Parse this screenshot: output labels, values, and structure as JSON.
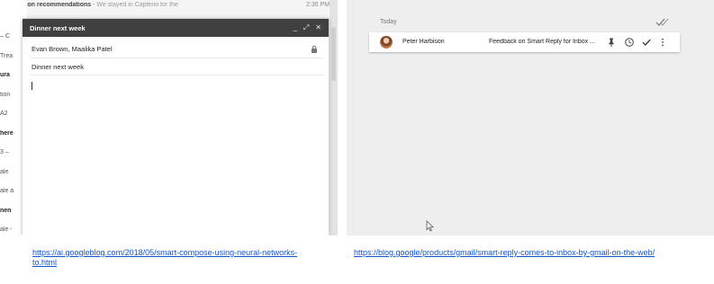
{
  "left_screenshot": {
    "background_inbox": {
      "top_text_bold": "ng/vacation recommendations",
      "top_text_rest": " - We stayed in Capterio for the",
      "top_time": "2:35 PM",
      "rows": [
        {
          "text": "– C",
          "bold": false
        },
        {
          "text": "Trea",
          "bold": false
        },
        {
          "text": "ura",
          "bold": true
        },
        {
          "text": "tion",
          "bold": false
        },
        {
          "text": "A2",
          "bold": false
        },
        {
          "text": "here",
          "bold": true
        },
        {
          "text": "3 –",
          "bold": false
        },
        {
          "text": "ale",
          "bold": false
        },
        {
          "text": "ale a",
          "bold": false
        },
        {
          "text": "nen",
          "bold": true
        },
        {
          "text": "ale -",
          "bold": false
        }
      ]
    },
    "compose": {
      "title": "Dinner next week",
      "to": "Evan Brown, Maalika Patel",
      "subject": "Dinner next week",
      "header_icons": [
        "minimize-icon",
        "expand-icon",
        "close-icon"
      ],
      "minimize_glyph": "_",
      "expand_glyph": "⤢",
      "close_glyph": "✕"
    }
  },
  "right_screenshot": {
    "section_label": "Today",
    "email_row": {
      "sender": "Peter Harbison",
      "subject": "Feedback on Smart Reply for Inbox ...",
      "action_icons": [
        "pin-icon",
        "snooze-clock-icon",
        "done-check-icon",
        "more-vert-icon"
      ]
    }
  },
  "captions": {
    "left": "https://ai.googleblog.com/2018/05/smart-compose-using-neural-networks-to.html",
    "right": "https://blog.google/products/gmail/smart-reply-comes-to-inbox-by-gmail-on-the-web/"
  },
  "colors": {
    "compose_header": "#404040",
    "link": "#1155cc",
    "right_background": "#eeeeee"
  }
}
